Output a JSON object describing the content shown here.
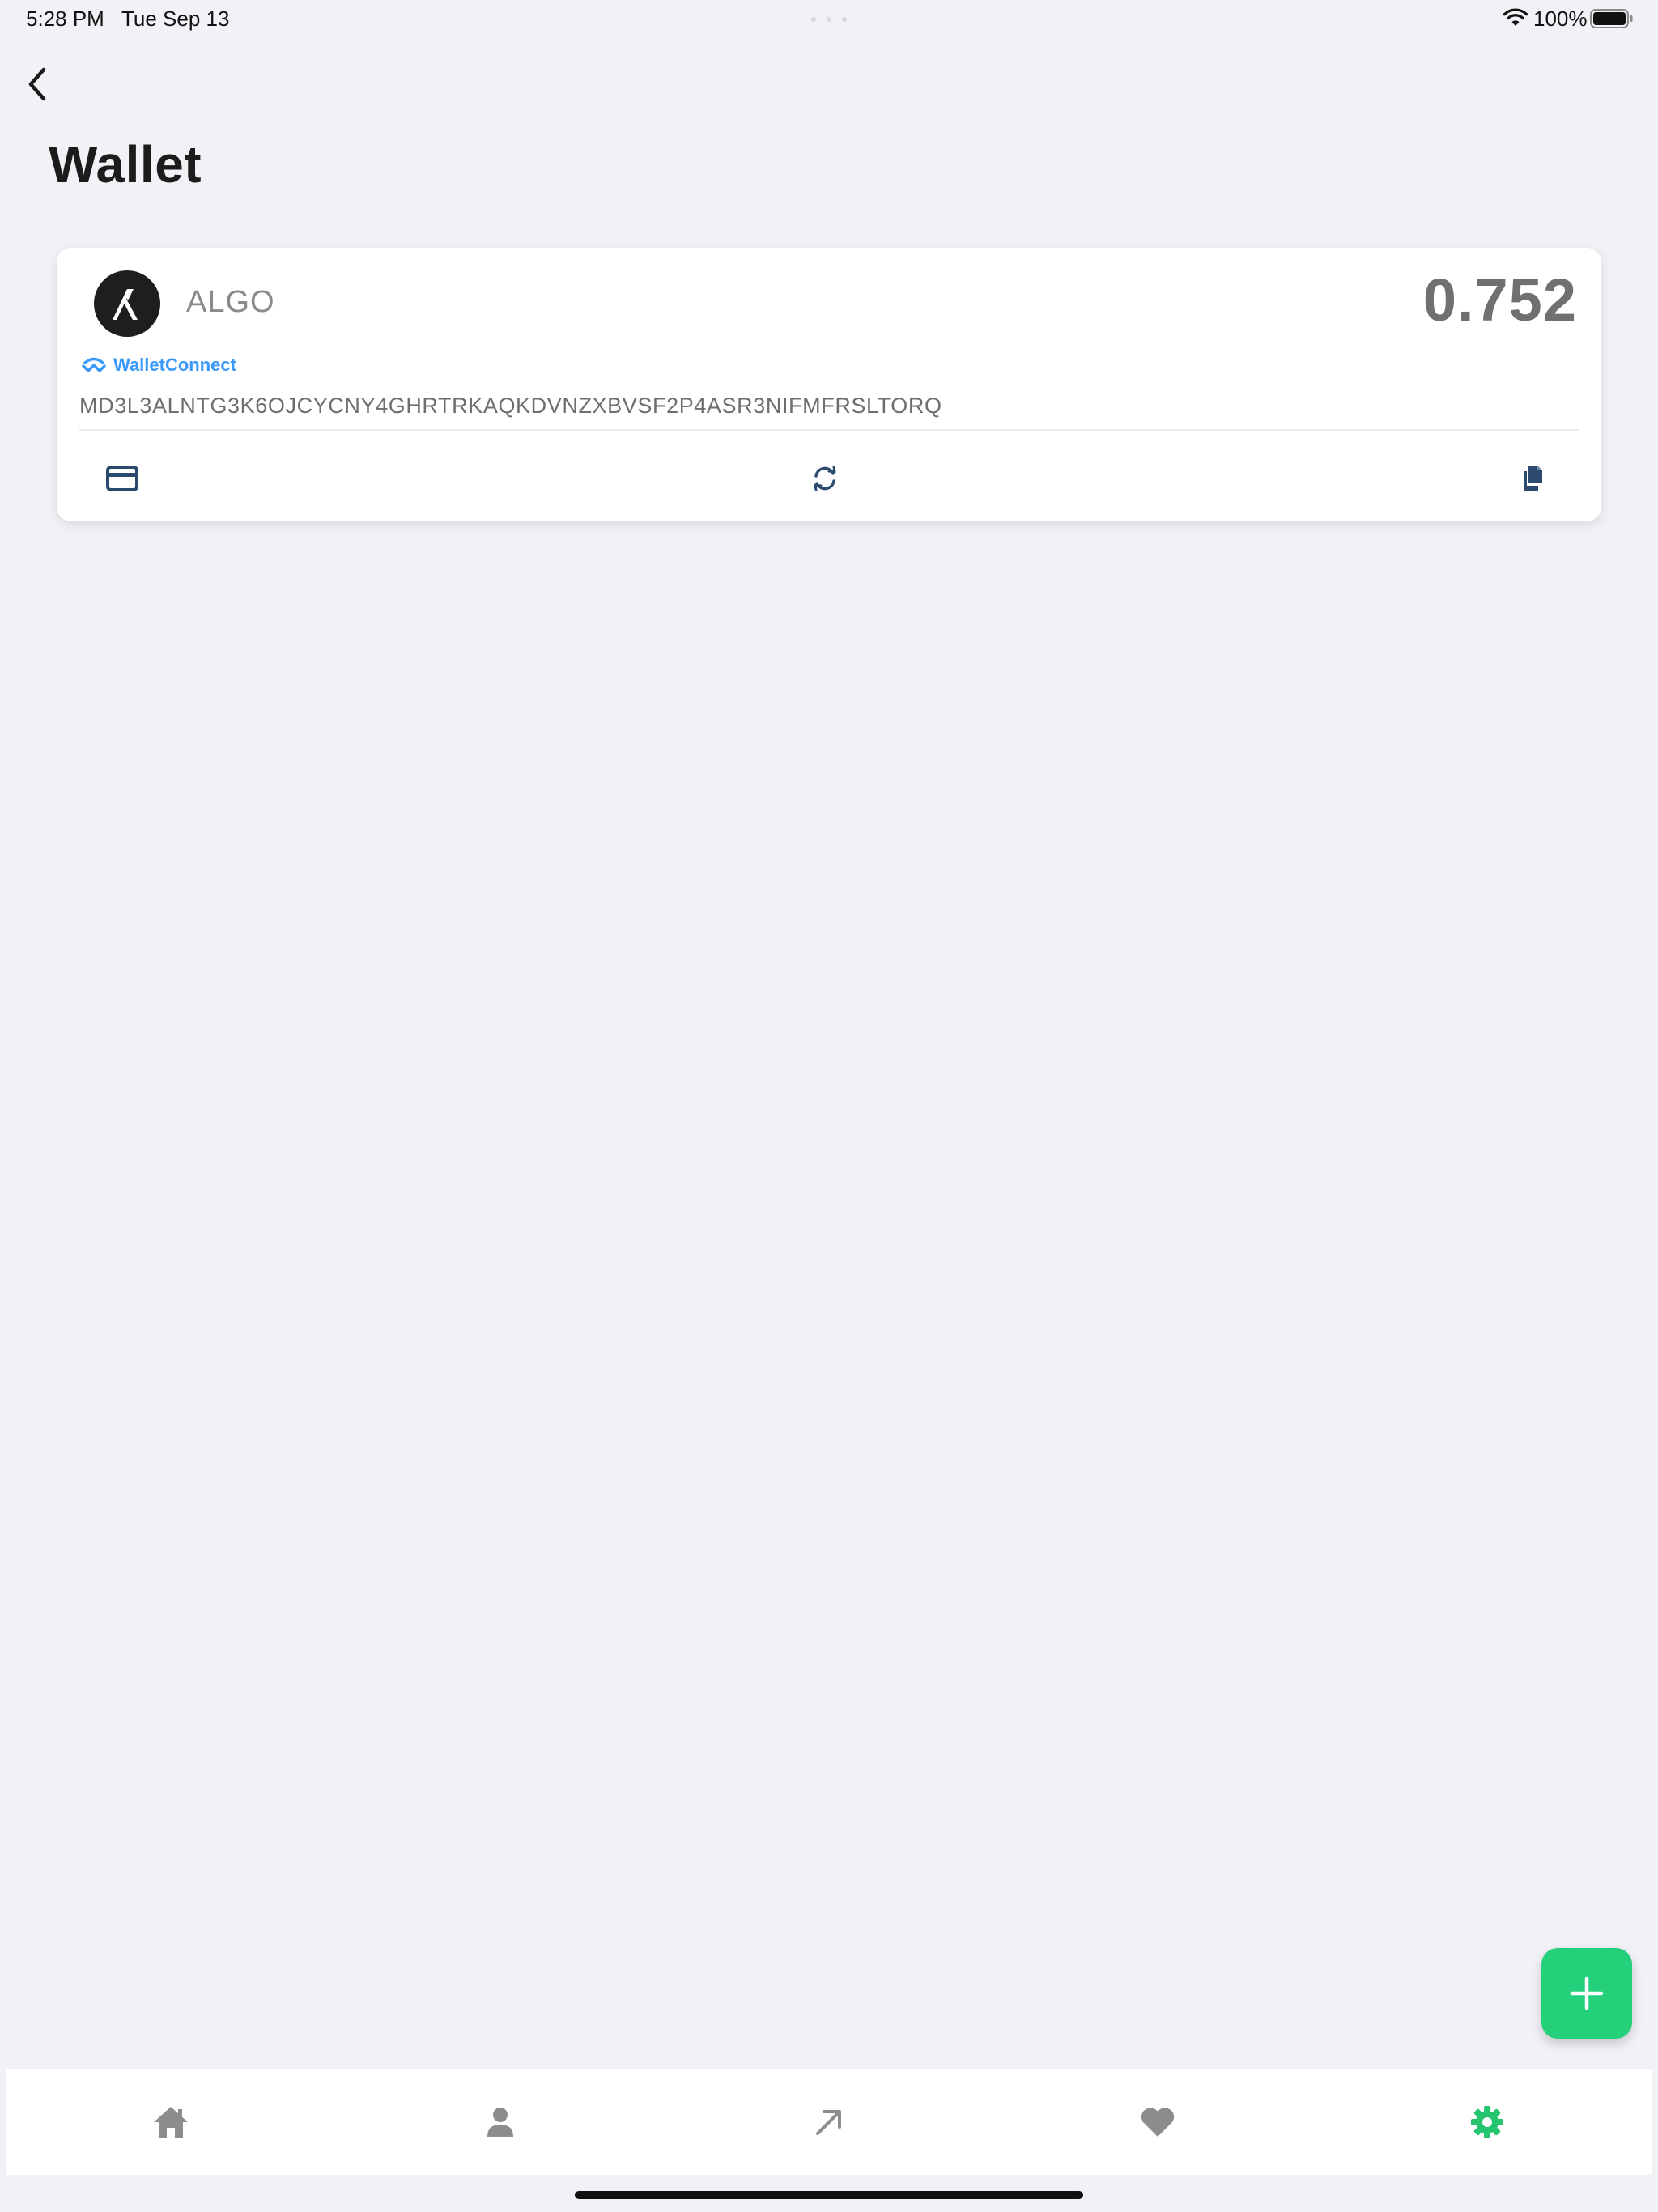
{
  "status_bar": {
    "time": "5:28 PM",
    "date": "Tue Sep 13",
    "battery_percent": "100%",
    "battery_level": 1.0
  },
  "header": {
    "back_icon": "chevron-left-icon",
    "title": "Wallet"
  },
  "wallet_card": {
    "coin": "ALGO",
    "coin_icon": "algorand-logo",
    "balance": "0.752",
    "connector": "WalletConnect",
    "connector_color": "#3b99fc",
    "address": "MD3L3ALNTG3K6OJCYCNY4GHRTRKAQKDVNZXBVSF2P4ASR3NIFMFRSLTORQ",
    "actions": [
      {
        "name": "card",
        "icon": "credit-card-icon"
      },
      {
        "name": "refresh",
        "icon": "refresh-icon"
      },
      {
        "name": "copy",
        "icon": "copy-icon"
      }
    ]
  },
  "fab": {
    "icon": "plus-icon",
    "color": "#25d07a"
  },
  "tab_bar": {
    "tabs": [
      {
        "name": "home",
        "icon": "home-icon",
        "active": false
      },
      {
        "name": "profile",
        "icon": "person-icon",
        "active": false
      },
      {
        "name": "send",
        "icon": "arrow-up-right-icon",
        "active": false
      },
      {
        "name": "favorites",
        "icon": "heart-icon",
        "active": false
      },
      {
        "name": "settings",
        "icon": "gear-icon",
        "active": true
      }
    ],
    "active_color": "#25c46f",
    "inactive_color": "#8c8c8c"
  }
}
